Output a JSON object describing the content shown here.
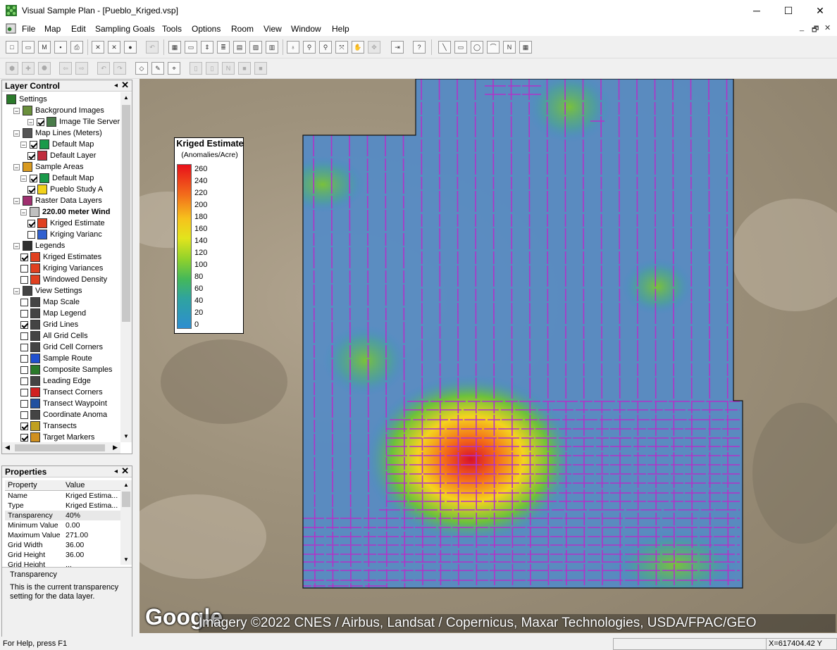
{
  "window": {
    "title": "Visual Sample Plan - [Pueblo_Kriged.vsp]",
    "minimize": "─",
    "maximize": "☐",
    "close": "✕"
  },
  "menu": [
    "File",
    "Map",
    "Edit",
    "Sampling Goals",
    "Tools",
    "Options",
    "Room",
    "View",
    "Window",
    "Help"
  ],
  "mdi": {
    "min": "_",
    "restore": "🗗",
    "close": "✕"
  },
  "layer_control": {
    "title": "Layer Control",
    "pin": "◂",
    "close": "✕",
    "items": [
      {
        "label": "Settings",
        "icon": "settings-icon"
      },
      {
        "label": "Background Images",
        "icon": "background-images-icon"
      },
      {
        "label": "Image Tile Server",
        "checked": true,
        "icon": "image-tile-server-icon"
      },
      {
        "label": "Map Lines (Meters)",
        "icon": "map-lines-icon"
      },
      {
        "label": "Default Map",
        "checked": true,
        "icon": "default-map-icon"
      },
      {
        "label": "Default Layer",
        "checked": true,
        "icon": "default-layer-icon"
      },
      {
        "label": "Sample Areas",
        "icon": "sample-areas-icon"
      },
      {
        "label": "Default Map",
        "checked": true,
        "icon": "default-map-icon"
      },
      {
        "label": "Pueblo Study A",
        "checked": true,
        "icon": "study-area-icon"
      },
      {
        "label": "Raster Data Layers",
        "icon": "raster-data-icon"
      },
      {
        "label": "220.00 meter Wind",
        "icon": "raster-layer-icon"
      },
      {
        "label": "Kriged Estimate",
        "checked": true,
        "icon": "kriged-estimate-icon"
      },
      {
        "label": "Kriging Varianc",
        "checked": false,
        "icon": "kriging-variance-icon"
      },
      {
        "label": "Legends",
        "icon": "legends-icon"
      },
      {
        "label": "Kriged Estimates",
        "checked": true,
        "icon": "legend-icon"
      },
      {
        "label": "Kriging Variances",
        "checked": false,
        "icon": "legend-icon"
      },
      {
        "label": "Windowed Density",
        "checked": false,
        "icon": "legend-icon"
      },
      {
        "label": "View Settings",
        "icon": "view-settings-icon"
      },
      {
        "label": "Map Scale",
        "checked": false,
        "icon": "map-scale-icon"
      },
      {
        "label": "Map Legend",
        "checked": false,
        "icon": "map-legend-icon"
      },
      {
        "label": "Grid Lines",
        "checked": true,
        "icon": "grid-lines-icon"
      },
      {
        "label": "All Grid Cells",
        "checked": false,
        "icon": "grid-cells-icon"
      },
      {
        "label": "Grid Cell Corners",
        "checked": false,
        "icon": "grid-corners-icon"
      },
      {
        "label": "Sample Route",
        "checked": false,
        "icon": "sample-route-icon"
      },
      {
        "label": "Composite Samples",
        "checked": false,
        "icon": "composite-samples-icon"
      },
      {
        "label": "Leading Edge",
        "checked": false,
        "icon": "leading-edge-icon"
      },
      {
        "label": "Transect Corners",
        "checked": false,
        "icon": "transect-corners-icon"
      },
      {
        "label": "Transect Waypoint",
        "checked": false,
        "icon": "transect-waypoint-icon"
      },
      {
        "label": "Coordinate Anoma",
        "checked": false,
        "icon": "coordinate-anomaly-icon"
      },
      {
        "label": "Transects",
        "checked": true,
        "icon": "transects-icon"
      },
      {
        "label": "Target Markers",
        "checked": true,
        "icon": "target-markers-icon"
      }
    ]
  },
  "properties": {
    "title": "Properties",
    "pin": "◂",
    "close": "✕",
    "col_property": "Property",
    "col_value": "Value",
    "rows": [
      {
        "k": "Name",
        "v": "Kriged Estima..."
      },
      {
        "k": "Type",
        "v": "Kriged Estima..."
      },
      {
        "k": "Transparency",
        "v": "40%"
      },
      {
        "k": "Minimum Value",
        "v": "0.00"
      },
      {
        "k": "Maximum Value",
        "v": "271.00"
      },
      {
        "k": "Grid Width",
        "v": "36.00"
      },
      {
        "k": "Grid Height",
        "v": "36.00"
      },
      {
        "k": "Grid Height",
        "v": "..."
      }
    ],
    "desc_title": "Transparency",
    "desc_text": "This is the current transparency setting for the data layer."
  },
  "legend": {
    "title": "Kriged Estimate",
    "subtitle": "(Anomalies/Acre)",
    "ticks": [
      "260",
      "240",
      "220",
      "200",
      "180",
      "160",
      "140",
      "120",
      "100",
      "80",
      "60",
      "40",
      "20",
      "0"
    ]
  },
  "map": {
    "attribution": "Imagery ©2022 CNES / Airbus, Landsat / Copernicus, Maxar Technologies, USDA/FPAC/GEO",
    "logo": "Google"
  },
  "status": {
    "help": "For Help, press F1",
    "coords": "X=617404.42 Y"
  }
}
